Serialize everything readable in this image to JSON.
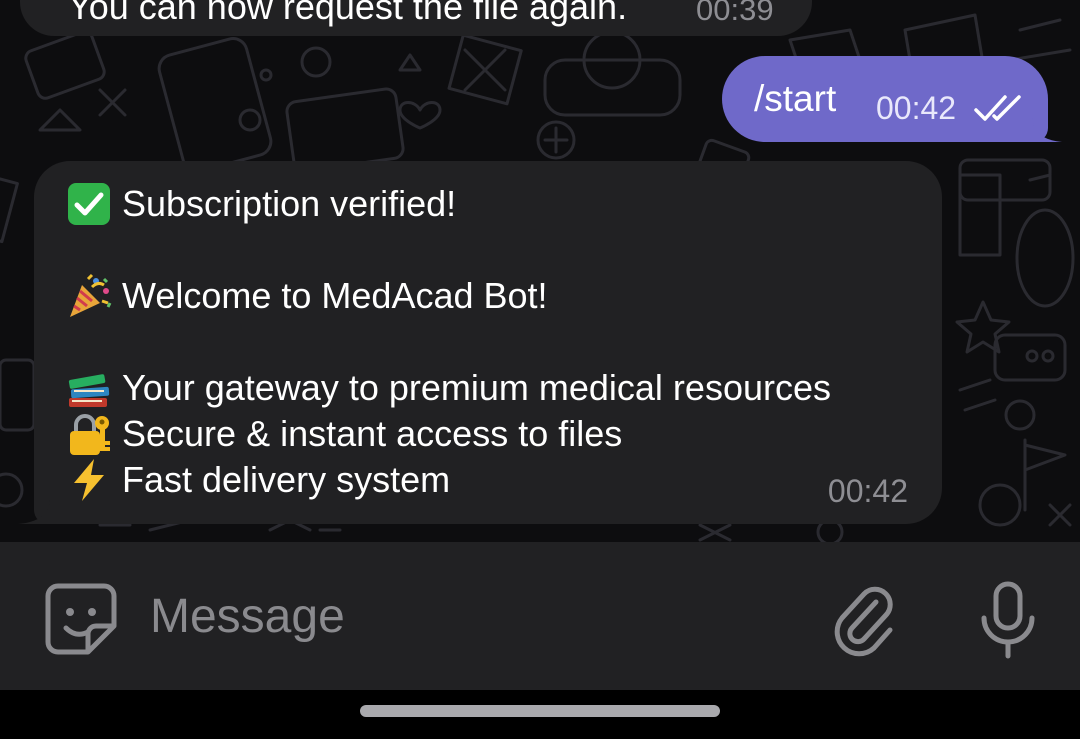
{
  "chat": {
    "previous_message": {
      "text": "You can now request the file again.",
      "time": "00:39"
    },
    "outgoing_message": {
      "text": "/start",
      "time": "00:42",
      "status_icon": "double-check-icon"
    },
    "incoming_message": {
      "lines": [
        {
          "icon": "check-mark-button-emoji",
          "text": "Subscription verified!"
        },
        {
          "icon": "party-popper-emoji",
          "text": "Welcome to MedAcad Bot!"
        },
        {
          "icon": "books-emoji",
          "text": "Your gateway to premium medical resources"
        },
        {
          "icon": "lock-with-key-emoji",
          "text": "Secure & instant access to files"
        },
        {
          "icon": "high-voltage-emoji",
          "text": "Fast delivery system"
        }
      ],
      "time": "00:42"
    }
  },
  "composer": {
    "placeholder": "Message",
    "value": "",
    "sticker_icon": "sticker-icon",
    "attach_icon": "paperclip-icon",
    "mic_icon": "microphone-icon"
  },
  "colors": {
    "chat_background": "#0d0d0f",
    "incoming_bubble": "#212123",
    "outgoing_bubble": "#6f69c9",
    "input_bar": "#212123",
    "muted_text": "#8e8e93"
  }
}
